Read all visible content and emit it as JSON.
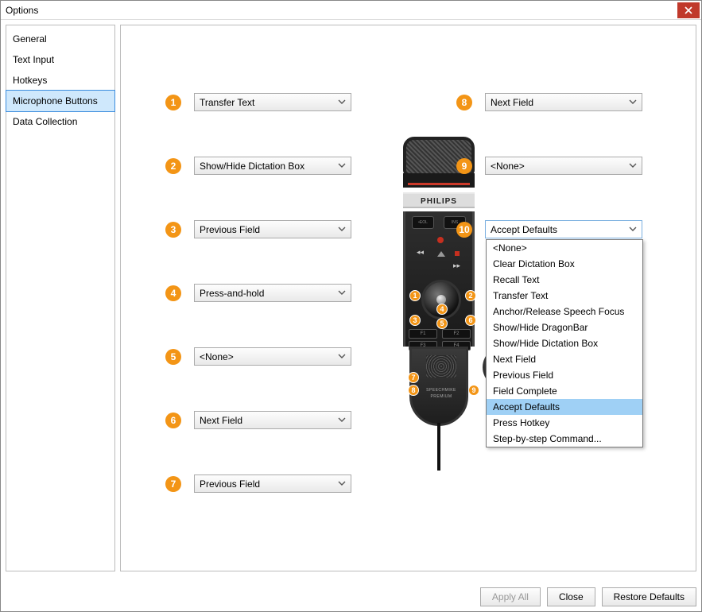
{
  "window": {
    "title": "Options"
  },
  "sidebar": {
    "items": [
      {
        "label": "General"
      },
      {
        "label": "Text Input"
      },
      {
        "label": "Hotkeys"
      },
      {
        "label": "Microphone Buttons"
      },
      {
        "label": "Data Collection"
      }
    ],
    "selected_index": 3
  },
  "mic": {
    "brand": "PHILIPS",
    "model_line1": "SPEECHMIKE",
    "model_line2": "PREMIUM"
  },
  "left_assignments": [
    {
      "num": "1",
      "value": "Transfer Text"
    },
    {
      "num": "2",
      "value": "Show/Hide Dictation Box"
    },
    {
      "num": "3",
      "value": "Previous Field"
    },
    {
      "num": "4",
      "value": "Press-and-hold"
    },
    {
      "num": "5",
      "value": "<None>"
    },
    {
      "num": "6",
      "value": "Next Field"
    },
    {
      "num": "7",
      "value": "Previous Field"
    }
  ],
  "right_assignments": [
    {
      "num": "8",
      "value": "Next Field"
    },
    {
      "num": "9",
      "value": "<None>"
    },
    {
      "num": "10",
      "value": "Accept Defaults",
      "open": true
    }
  ],
  "dropdown_options": [
    "<None>",
    "Clear Dictation Box",
    "Recall Text",
    "Transfer Text",
    "Anchor/Release Speech Focus",
    "Show/Hide DragonBar",
    "Show/Hide Dictation Box",
    "Next Field",
    "Previous Field",
    "Field Complete",
    "Accept Defaults",
    "Press Hotkey",
    "Step-by-step Command..."
  ],
  "dropdown_selected": "Accept Defaults",
  "footer": {
    "apply_all": "Apply All",
    "close": "Close",
    "restore": "Restore Defaults"
  },
  "colors": {
    "badge": "#f39516",
    "selection": "#cfe8fc",
    "close": "#c0392b"
  }
}
